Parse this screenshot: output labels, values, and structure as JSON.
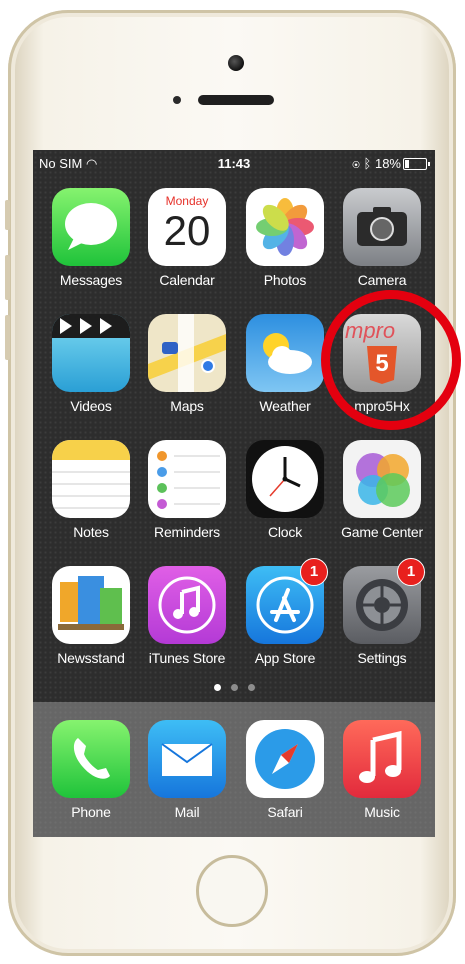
{
  "status_bar": {
    "carrier": "No SIM",
    "time": "11:43",
    "battery": "18%",
    "battery_level": 0.18
  },
  "home_apps": [
    {
      "label": "Messages",
      "icon": "messages-icon"
    },
    {
      "label": "Calendar",
      "icon": "calendar-icon",
      "month": "Monday",
      "day": "20"
    },
    {
      "label": "Photos",
      "icon": "photos-icon"
    },
    {
      "label": "Camera",
      "icon": "camera-icon"
    },
    {
      "label": "Videos",
      "icon": "videos-icon"
    },
    {
      "label": "Maps",
      "icon": "maps-icon"
    },
    {
      "label": "Weather",
      "icon": "weather-icon"
    },
    {
      "label": "mpro5Hx",
      "icon": "mpro-html5-icon",
      "icon_text": "mpro",
      "icon_number": "5"
    },
    {
      "label": "Notes",
      "icon": "notes-icon"
    },
    {
      "label": "Reminders",
      "icon": "reminders-icon"
    },
    {
      "label": "Clock",
      "icon": "clock-icon"
    },
    {
      "label": "Game Center",
      "icon": "game-center-icon"
    },
    {
      "label": "Newsstand",
      "icon": "newsstand-icon"
    },
    {
      "label": "iTunes Store",
      "icon": "itunes-store-icon"
    },
    {
      "label": "App Store",
      "icon": "app-store-icon",
      "badge": "1"
    },
    {
      "label": "Settings",
      "icon": "settings-icon",
      "badge": "1"
    }
  ],
  "dock_apps": [
    {
      "label": "Phone",
      "icon": "phone-icon"
    },
    {
      "label": "Mail",
      "icon": "mail-icon"
    },
    {
      "label": "Safari",
      "icon": "safari-icon"
    },
    {
      "label": "Music",
      "icon": "music-icon"
    }
  ],
  "page_indicator": {
    "count": 3,
    "current": 1
  },
  "colors": {
    "highlight": "#e4000f",
    "badge": "#e8201d",
    "screen_bg": "#2d2d2d",
    "phone_body": "#f6f2e8"
  }
}
